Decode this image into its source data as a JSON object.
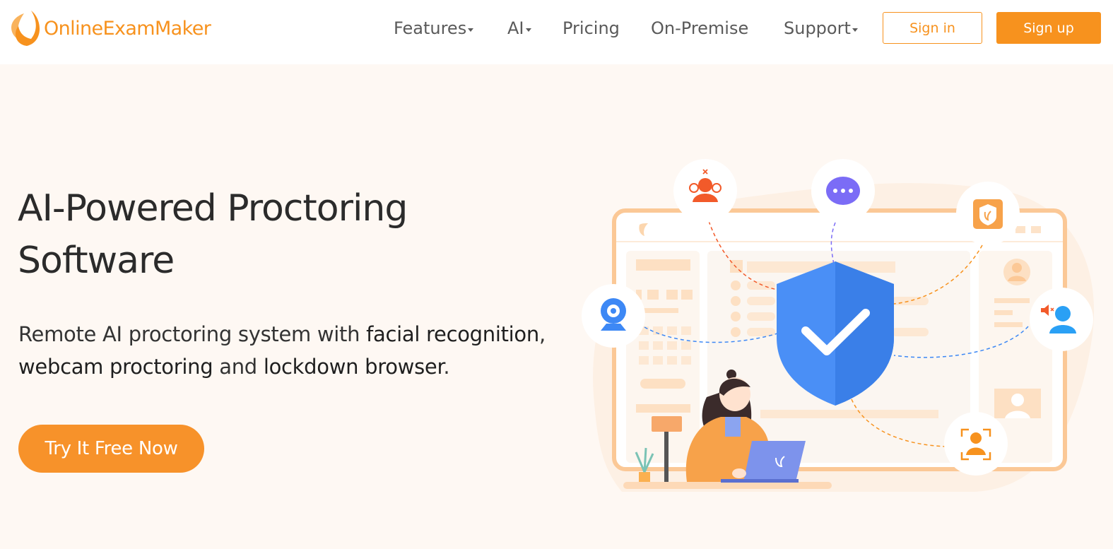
{
  "brand": {
    "name": "OnlineExamMaker",
    "color": "#f7921e"
  },
  "nav": {
    "items": [
      {
        "label": "Features",
        "dropdown": true
      },
      {
        "label": "AI",
        "dropdown": true
      },
      {
        "label": "Pricing",
        "dropdown": false
      },
      {
        "label": "On-Premise",
        "dropdown": false
      },
      {
        "label": "Support",
        "dropdown": true
      }
    ],
    "signin_label": "Sign in",
    "signup_label": "Sign up"
  },
  "hero": {
    "title_line1": "AI-Powered Proctoring",
    "title_line2": "Software",
    "sub_part1": "Remote AI proctoring system with ",
    "sub_hl1": "facial recognition",
    "sub_part2": ",",
    "sub_hl2": "webcam proctoring",
    "sub_part3": " and ",
    "sub_hl3": "lockdown browser",
    "sub_part4": ".",
    "cta_label": "Try It Free Now"
  },
  "illustration": {
    "icons": [
      "group-alert-icon",
      "chat-bubble-icon",
      "shield-logo-icon",
      "webcam-icon",
      "muted-user-icon",
      "face-scan-icon"
    ],
    "colors": {
      "shield": "#3d88f5",
      "accent": "#f7921e",
      "chat": "#7b6cf6",
      "alert": "#f25a2a"
    }
  }
}
